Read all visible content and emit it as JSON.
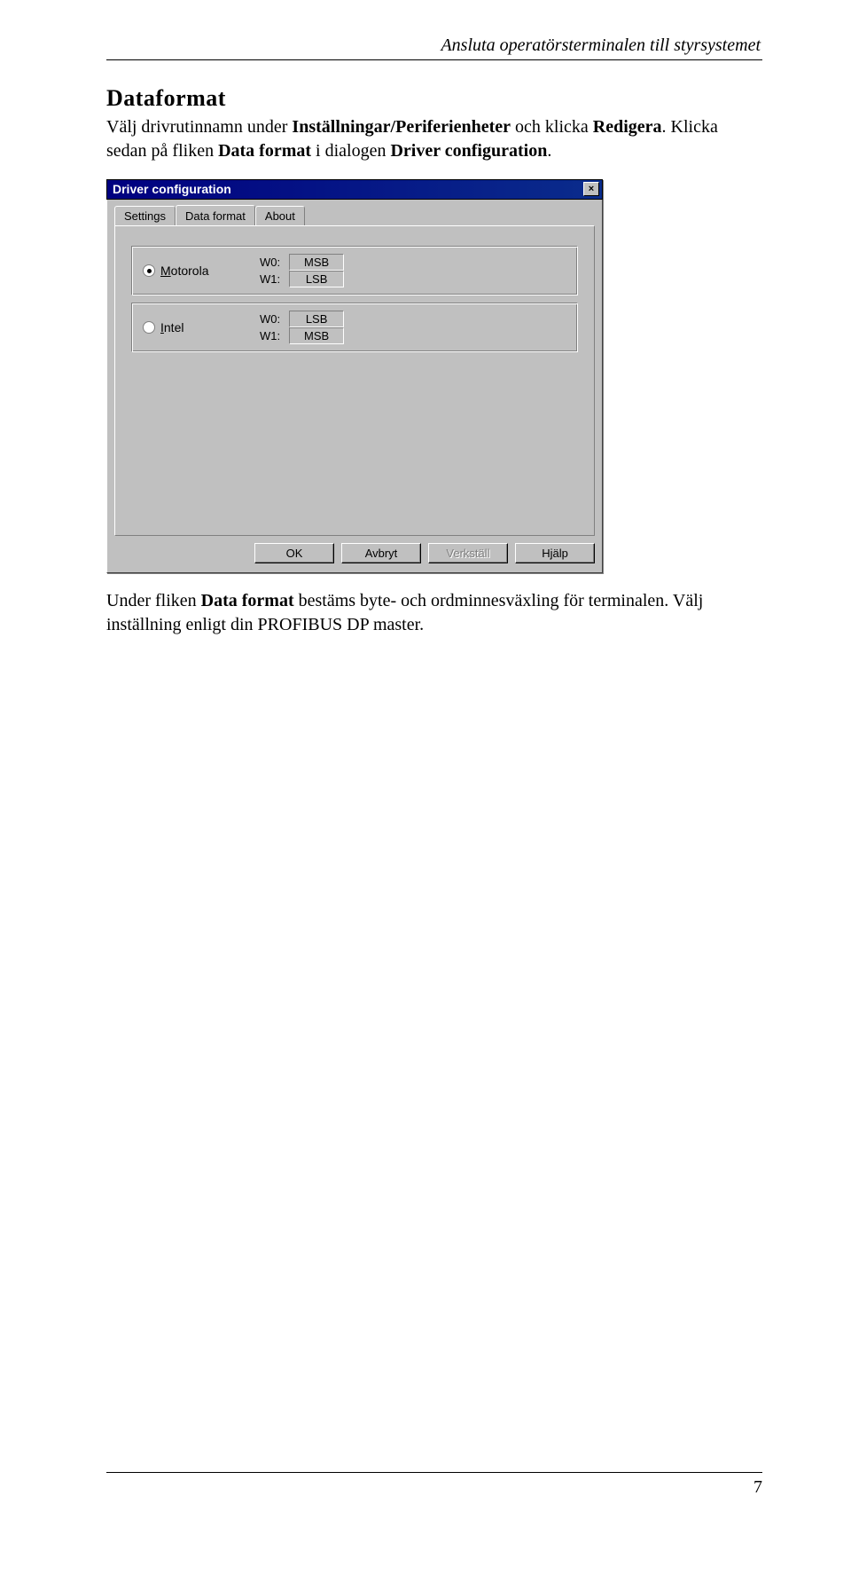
{
  "header": {
    "running_title": "Ansluta operatörsterminalen till styrsystemet"
  },
  "section": {
    "title": "Dataformat",
    "para1_a": "Välj drivrutinnamn under ",
    "para1_b": "Inställningar/Periferienheter",
    "para1_c": " och klicka ",
    "para1_d": "Redigera",
    "para1_e": ". Klicka sedan på fliken ",
    "para1_f": "Data format",
    "para1_g": " i dialogen ",
    "para1_h": "Driver configuration",
    "para1_i": "."
  },
  "dialog": {
    "title": "Driver configuration",
    "close": "×",
    "tabs": {
      "settings": "Settings",
      "dataformat": "Data format",
      "about": "About"
    },
    "options": [
      {
        "radio_label": "Motorola",
        "underline_index": 0,
        "selected": true,
        "rows": [
          {
            "w": "W0:",
            "val": "MSB"
          },
          {
            "w": "W1:",
            "val": "LSB"
          }
        ]
      },
      {
        "radio_label": "Intel",
        "underline_index": 0,
        "selected": false,
        "rows": [
          {
            "w": "W0:",
            "val": "LSB"
          },
          {
            "w": "W1:",
            "val": "MSB"
          }
        ]
      }
    ],
    "buttons": {
      "ok": "OK",
      "cancel": "Avbryt",
      "apply": "Verkställ",
      "help": "Hjälp"
    }
  },
  "after": {
    "para_a": "Under fliken ",
    "para_b": "Data format",
    "para_c": " bestäms byte- och ordminnesväxling för terminalen. Välj inställning enligt din PROFIBUS DP master."
  },
  "page_number": "7"
}
